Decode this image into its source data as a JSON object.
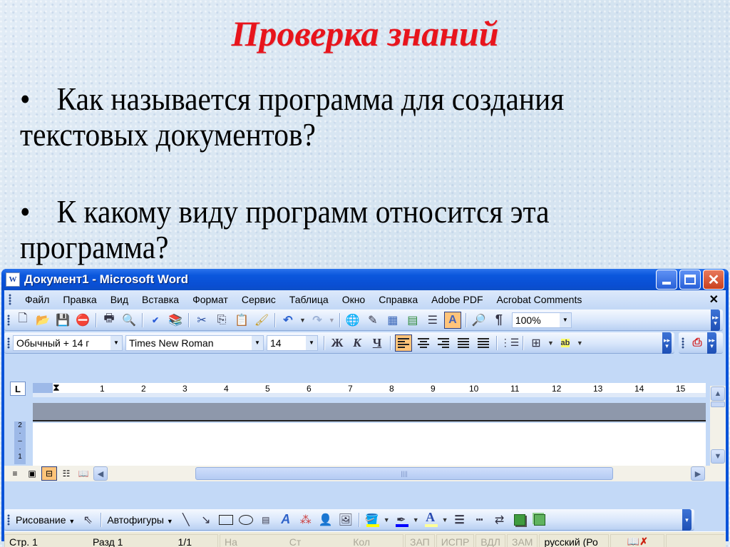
{
  "slide": {
    "title": "Проверка знаний",
    "bullet_char": "•",
    "bullets": [
      {
        "line1": "Как называется программа для создания",
        "line2": "текстовых документов?"
      },
      {
        "line1": "К какому виду программ относится эта",
        "line2": "программа?"
      }
    ]
  },
  "window": {
    "title": "Документ1 - Microsoft Word",
    "app_icon_label": "W",
    "minimize_label": "",
    "maximize_label": "",
    "close_label": "✕"
  },
  "menu": {
    "items": [
      "Файл",
      "Правка",
      "Вид",
      "Вставка",
      "Формат",
      "Сервис",
      "Таблица",
      "Окно",
      "Справка",
      "Adobe PDF",
      "Acrobat Comments"
    ],
    "close_label": "✕"
  },
  "standard_toolbar": {
    "zoom_value": "100%"
  },
  "formatting_toolbar": {
    "style_value": "Обычный + 14 г",
    "font_value": "Times New Roman",
    "size_value": "14",
    "bold_label": "Ж",
    "italic_label": "К",
    "underline_label": "Ч",
    "paragraph_mark": "¶",
    "active_alignment": "left"
  },
  "ruler": {
    "numbers": [
      "1",
      "2",
      "3",
      "4",
      "5",
      "6",
      "7",
      "8",
      "9",
      "10",
      "11",
      "12",
      "13",
      "14",
      "15"
    ],
    "vertical_numbers": [
      "2",
      "1"
    ],
    "tab_selector": "L"
  },
  "drawing_toolbar": {
    "drawing_label": "Рисование",
    "autoshapes_label": "Автофигуры",
    "fill_color": "#ffff00",
    "line_color": "#0000ff",
    "font_color": "#ffff99"
  },
  "status_bar": {
    "page": "Стр. 1",
    "section": "Разд 1",
    "pages": "1/1",
    "at": "На",
    "line": "Ст",
    "col": "Кол",
    "rec": "ЗАП",
    "trk": "ИСПР",
    "ext": "ВДЛ",
    "ovr": "ЗАМ",
    "language": "русский (Ро"
  },
  "colors": {
    "title_red": "#e8141c",
    "xp_blue": "#0a53d9",
    "active_orange": "#ffc47a"
  }
}
